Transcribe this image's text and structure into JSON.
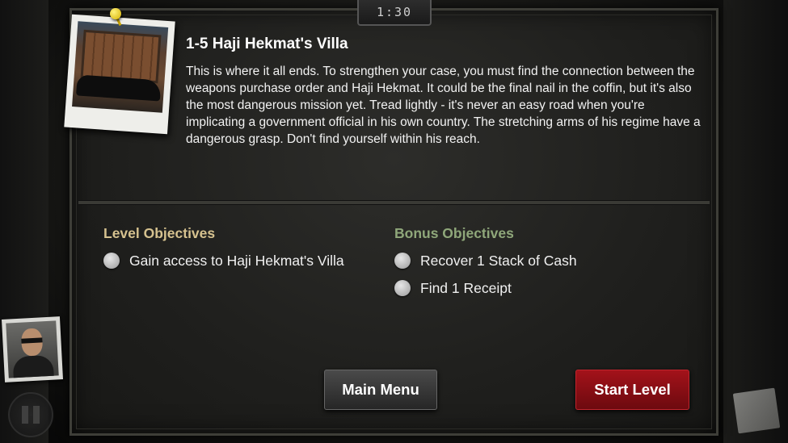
{
  "timer": {
    "value": "1:30"
  },
  "mission": {
    "title": "1-5 Haji Hekmat's Villa",
    "description": "This is where it all ends. To strengthen your case, you must find the connection between the weapons purchase order and Haji Hekmat. It could be the final nail in the coffin, but it's also the most dangerous mission yet. Tread lightly - it's never an easy road when you're implicating a government official in his own country. The stretching arms of his regime have a dangerous grasp. Don't find yourself within his reach."
  },
  "level_objectives": {
    "heading": "Level Objectives",
    "items": [
      {
        "label": "Gain access to Haji Hekmat's Villa"
      }
    ]
  },
  "bonus_objectives": {
    "heading": "Bonus Objectives",
    "items": [
      {
        "label": "Recover 1 Stack of Cash"
      },
      {
        "label": "Find 1 Receipt"
      }
    ]
  },
  "buttons": {
    "main_menu": "Main Menu",
    "start_level": "Start Level"
  },
  "colors": {
    "level_heading": "#d6c28f",
    "bonus_heading": "#8fa77a",
    "start_button": "#a3121a"
  },
  "icons": {
    "pause": "pause-icon",
    "notes": "paper-icon",
    "pin": "pushpin-icon"
  }
}
